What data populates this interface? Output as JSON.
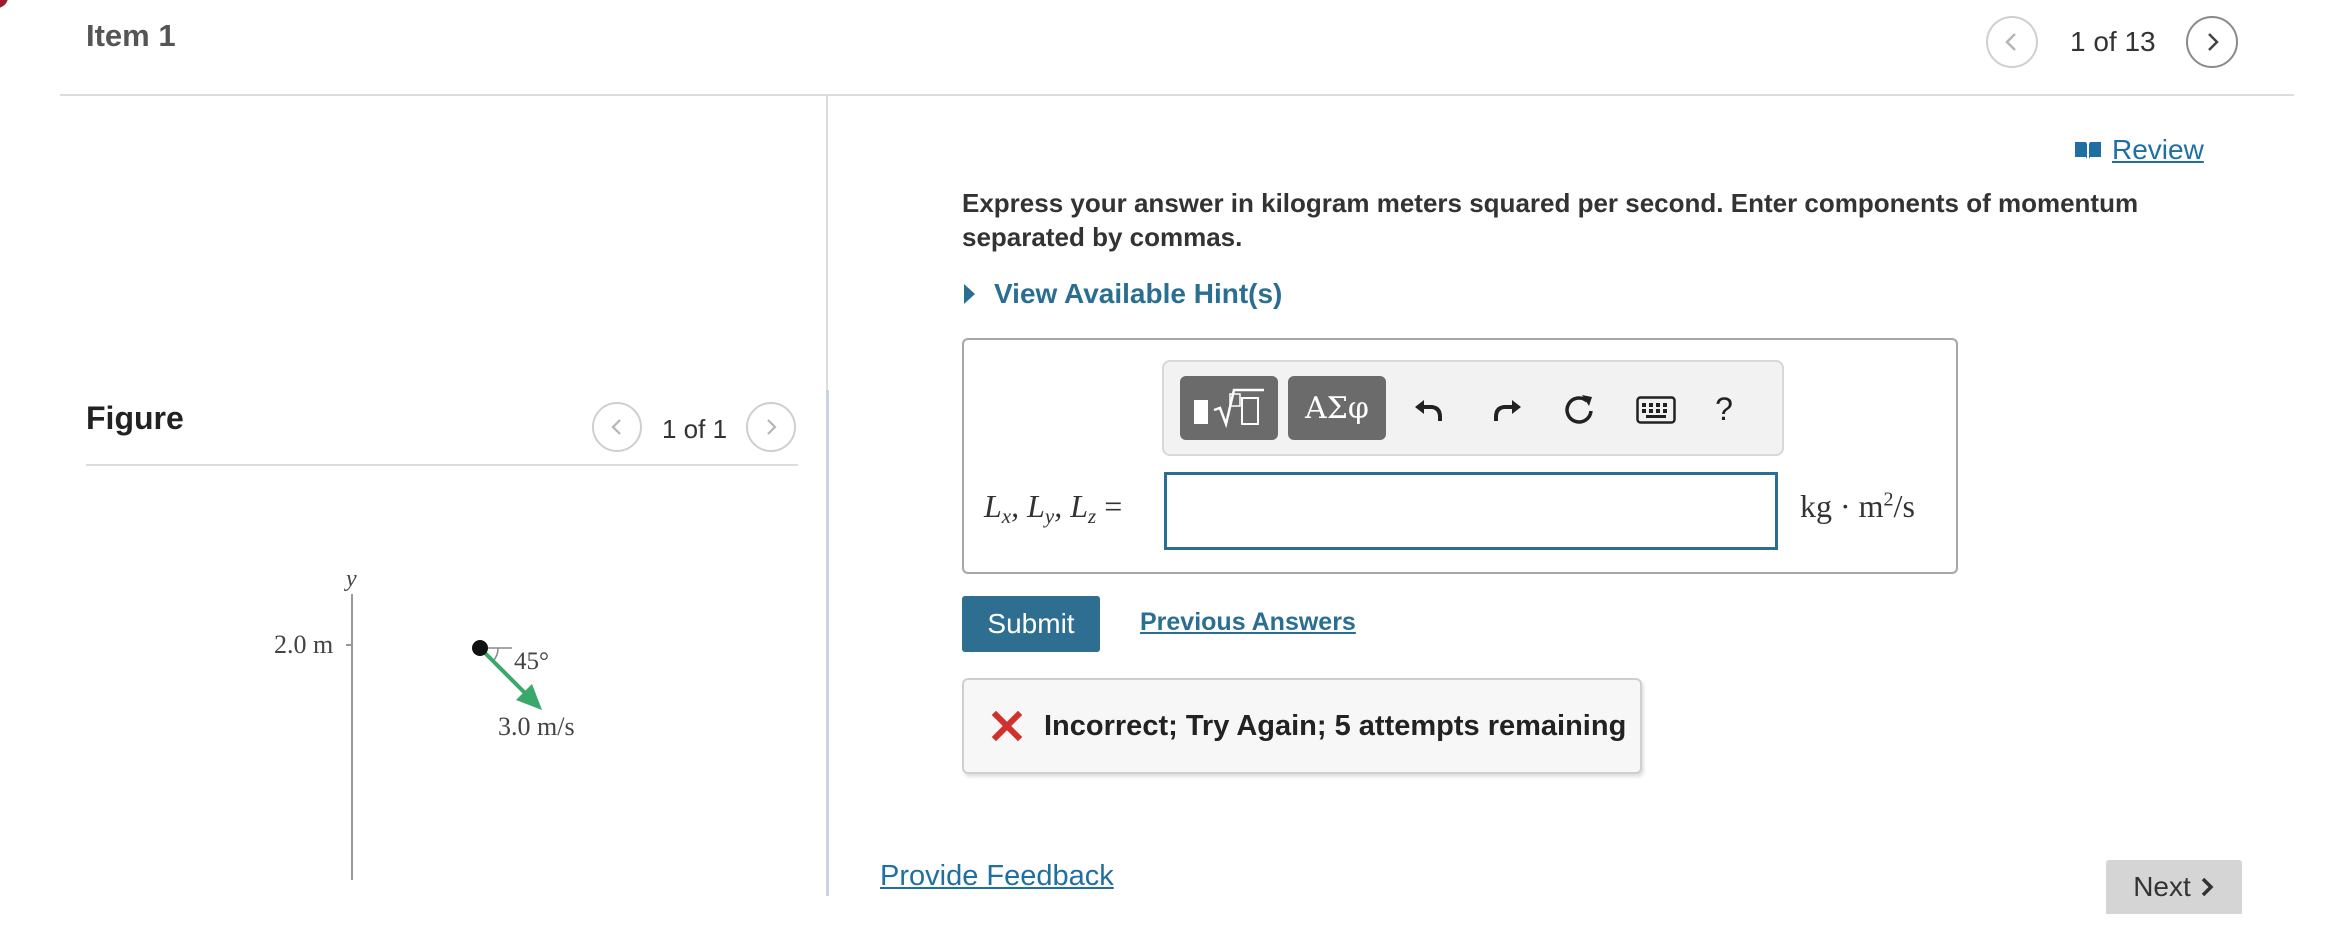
{
  "header": {
    "item_title": "Item 1",
    "pager_text": "1 of 13"
  },
  "figure": {
    "title": "Figure",
    "pager_text": "1 of 1",
    "y_axis_label": "y",
    "height_label": "2.0 m",
    "angle_label": "45°",
    "speed_label": "3.0 m/s"
  },
  "question": {
    "review_label": "Review",
    "instructions": "Express your answer in kilogram meters squared per second. Enter components of momentum separated by commas.",
    "hint_label": "View Available Hint(s)",
    "toolbar": {
      "symbols_label": "ΑΣφ",
      "help_label": "?"
    },
    "answer_value": "",
    "submit_label": "Submit",
    "previous_answers_label": "Previous Answers",
    "feedback_text": "Incorrect; Try Again; 5 attempts remaining"
  },
  "footer": {
    "provide_feedback_label": "Provide Feedback",
    "next_label": "Next"
  },
  "colors": {
    "accent": "#2e6e90",
    "link": "#1f6fa3",
    "error": "#d0312d",
    "arrow": "#3aa86b"
  }
}
